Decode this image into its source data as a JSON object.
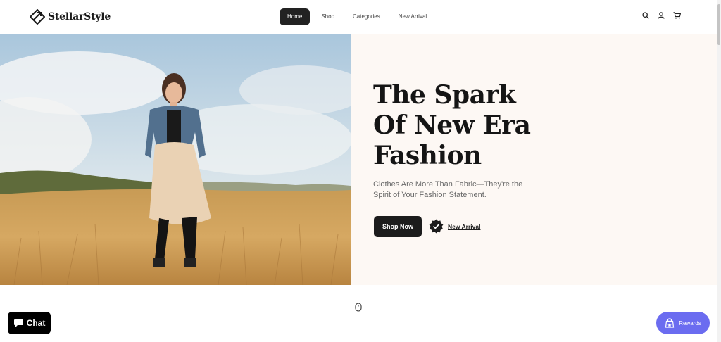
{
  "brand": {
    "name": "StellarStyle"
  },
  "nav": {
    "items": [
      {
        "label": "Home",
        "active": true
      },
      {
        "label": "Shop",
        "active": false
      },
      {
        "label": "Categories",
        "active": false
      },
      {
        "label": "New Arrival",
        "active": false
      }
    ]
  },
  "header_icons": [
    "search-icon",
    "user-icon",
    "cart-icon"
  ],
  "hero": {
    "title_lines": [
      "The Spark",
      "Of New Era",
      "Fashion"
    ],
    "subtitle": "Clothes Are More Than Fabric—They're the Spirit of Your Fashion Statement.",
    "cta_primary": "Shop Now",
    "cta_secondary": "New Arrival"
  },
  "widgets": {
    "chat_label": "Chat",
    "rewards_label": "Rewards"
  },
  "colors": {
    "panel_bg": "#fdf8f4",
    "button_dark": "#1c1c1c",
    "rewards_accent": "#6b6cf0"
  }
}
